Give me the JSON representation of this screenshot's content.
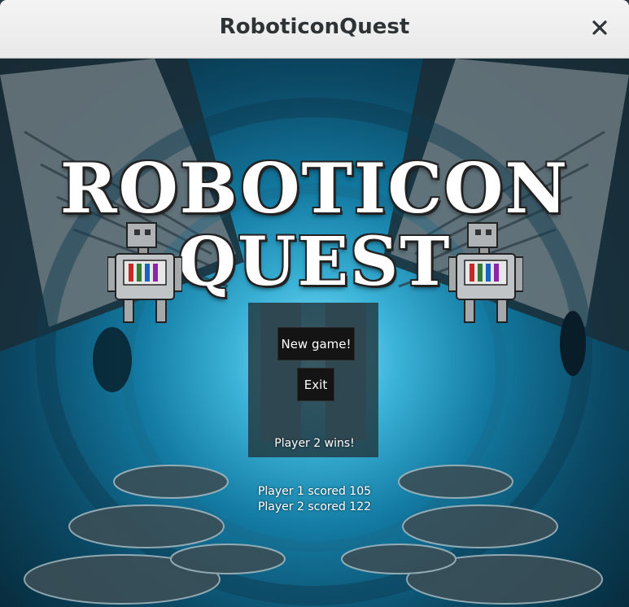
{
  "window": {
    "title": "RoboticonQuest"
  },
  "logo": {
    "line1": "ROBOTICON",
    "line2": "QUEST"
  },
  "menu": {
    "new_game_label": "New game!",
    "exit_label": "Exit"
  },
  "results": {
    "winner_text": "Player 2 wins!",
    "player1_score_text": "Player 1 scored 105",
    "player2_score_text": "Player 2 scored 122"
  },
  "icons": {
    "close": "close-icon",
    "robot": "robot-icon"
  },
  "colors": {
    "button_bg": "#141414",
    "tunnel_light": "#8fe6ff",
    "tunnel_dark": "#06222f"
  }
}
